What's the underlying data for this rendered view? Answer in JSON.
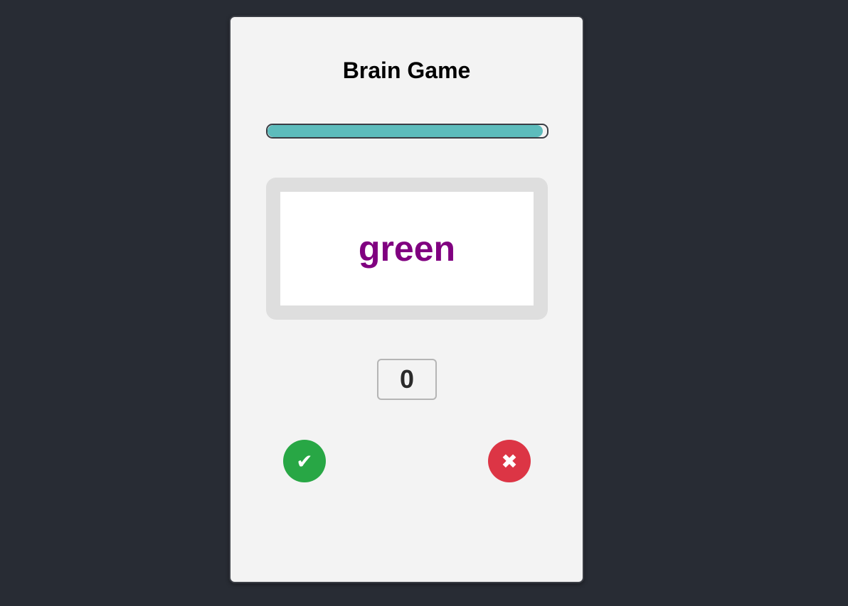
{
  "game": {
    "title": "Brain Game",
    "word": "green",
    "word_color": "#800080",
    "score": "0",
    "progress": 0.985
  },
  "colors": {
    "progress_fill": "#5dbcbc",
    "yes_button": "#28a745",
    "no_button": "#dc3545"
  },
  "buttons": {
    "yes": {
      "icon": "check-icon",
      "glyph": "✔"
    },
    "no": {
      "icon": "cross-icon",
      "glyph": "✖"
    }
  }
}
